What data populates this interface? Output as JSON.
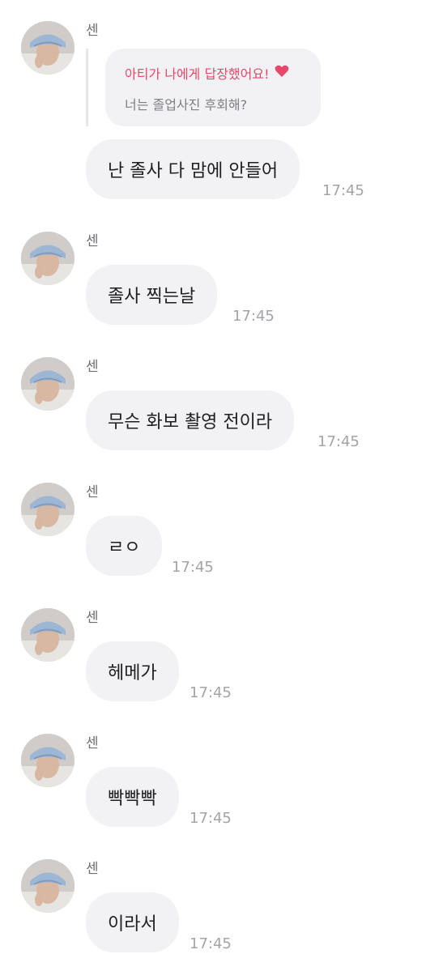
{
  "reply": {
    "header": "아티가 나에게 답장했어요!",
    "quoted": "너는 졸업사진 후회해?"
  },
  "messages": [
    {
      "sender": "센",
      "text": "난 졸사 다 맘에 안들어",
      "time": "17:45"
    },
    {
      "sender": "센",
      "text": "졸사 찍는날",
      "time": "17:45"
    },
    {
      "sender": "센",
      "text": "무슨 화보 촬영 전이라",
      "time": "17:45"
    },
    {
      "sender": "센",
      "text": "ㄹㅇ",
      "time": "17:45"
    },
    {
      "sender": "센",
      "text": "헤메가",
      "time": "17:45"
    },
    {
      "sender": "센",
      "text": "빡빡빡",
      "time": "17:45"
    },
    {
      "sender": "센",
      "text": "이라서",
      "time": "17:45"
    }
  ],
  "colors": {
    "bubble": "#f2f2f5",
    "reply_accent": "#e5486b",
    "timestamp": "#a3a3a8"
  },
  "icons": {
    "reply_heart": "heart-icon",
    "avatar": "profile-photo"
  }
}
